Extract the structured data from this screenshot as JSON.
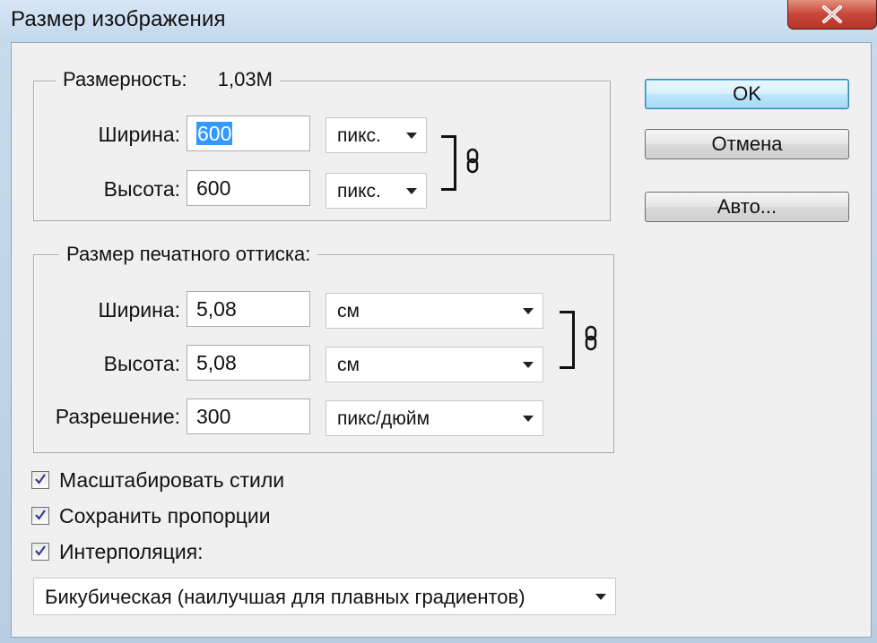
{
  "dialog": {
    "title": "Размер изображения",
    "close_icon": "close-icon"
  },
  "pixel_dimensions": {
    "legend": "Размерность:",
    "size_value": "1,03M",
    "width_label": "Ширина:",
    "width_value": "600",
    "width_unit": "пикс.",
    "height_label": "Высота:",
    "height_value": "600",
    "height_unit": "пикс.",
    "link_icon": "chain-link-icon"
  },
  "document_size": {
    "legend": "Размер печатного оттиска:",
    "width_label": "Ширина:",
    "width_value": "5,08",
    "width_unit": "см",
    "height_label": "Высота:",
    "height_value": "5,08",
    "height_unit": "см",
    "resolution_label": "Разрешение:",
    "resolution_value": "300",
    "resolution_unit": "пикс/дюйм",
    "link_icon": "chain-link-icon"
  },
  "buttons": {
    "ok": "OK",
    "cancel": "Отмена",
    "auto": "Авто..."
  },
  "options": {
    "scale_styles": {
      "label": "Масштабировать стили",
      "checked": true
    },
    "constrain_proportions": {
      "label": "Сохранить пропорции",
      "checked": true
    },
    "resample": {
      "label": "Интерполяция:",
      "checked": true
    },
    "resample_method": "Бикубическая (наилучшая для плавных градиентов)"
  },
  "colors": {
    "selection": "#3399ff",
    "default_button_border": "#3c7fb1",
    "close_button": "#c8473a"
  }
}
